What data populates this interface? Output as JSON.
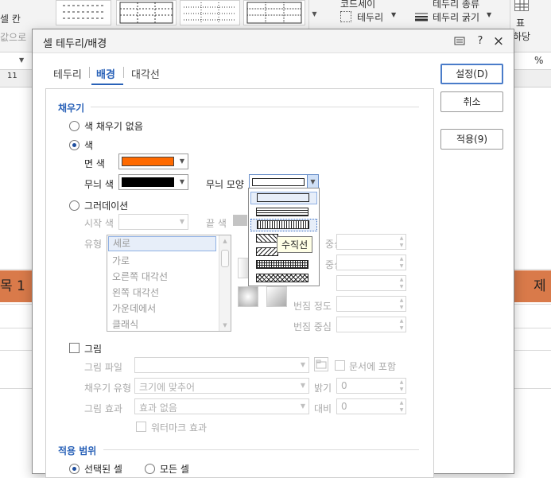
{
  "background": {
    "ribbon": {
      "left_frag_1": "셀 칸",
      "left_frag_2": "값으로",
      "border_menu": "테두리",
      "border_width_menu": "테두리 굵기",
      "top_right_label": "표",
      "right_label_frag": "하당",
      "top_partial_1": "코드세이",
      "top_partial_2": "테두리 종류"
    },
    "percent": "%",
    "column_number": "11",
    "cell_left": "목 1",
    "cell_right": "제"
  },
  "dialog": {
    "title": "셀 테두리/배경",
    "help_button": "?",
    "close_button": "×",
    "tabs": [
      {
        "label": "테두리",
        "active": false
      },
      {
        "label": "배경",
        "active": true
      },
      {
        "label": "대각선",
        "active": false
      }
    ],
    "buttons": {
      "ok": "설정(D)",
      "cancel": "취소",
      "apply": "적용(9)"
    },
    "fill": {
      "section_title": "채우기",
      "no_fill_label": "색 채우기 없음",
      "color_label": "색",
      "color_selected": true,
      "face_color_label": "면 색",
      "face_color": "#ff6a00",
      "pattern_color_label": "무늬 색",
      "pattern_color": "#000000",
      "pattern_shape_label": "무늬 모양",
      "gradient_label": "그러데이션",
      "start_color_label": "시작 색",
      "end_color_label": "끝 색",
      "type_label": "유형",
      "type_options": [
        "세로",
        "가로",
        "오른쪽 대각선",
        "왼쪽 대각선",
        "가운데에서",
        "클래식"
      ],
      "type_selected": "세로",
      "gradient_right_labels": [
        "중심",
        "중심",
        "번짐 정도",
        "번짐 중심"
      ],
      "picture_label": "그림",
      "picture_file_label": "그림 파일",
      "include_in_doc_label": "문서에 포함",
      "fill_type_label": "채우기 유형",
      "fill_type_value": "크기에 맞추어",
      "brightness_label": "밝기",
      "brightness_value": "0",
      "picture_effect_label": "그림 효과",
      "picture_effect_value": "효과 없음",
      "contrast_label": "대비",
      "contrast_value": "0",
      "watermark_label": "워터마크 효과"
    },
    "scope": {
      "section_title": "적용 범위",
      "selected_cells_label": "선택된 셀",
      "all_cells_label": "모든 셀",
      "selected": "selected_cells"
    },
    "pattern_popup": {
      "patterns": [
        "none",
        "horizontal-lines",
        "vertical-lines",
        "diagonal-right",
        "diagonal-left",
        "grid",
        "crosshatch"
      ],
      "highlighted": "vertical-lines",
      "tooltip": "수직선"
    }
  }
}
